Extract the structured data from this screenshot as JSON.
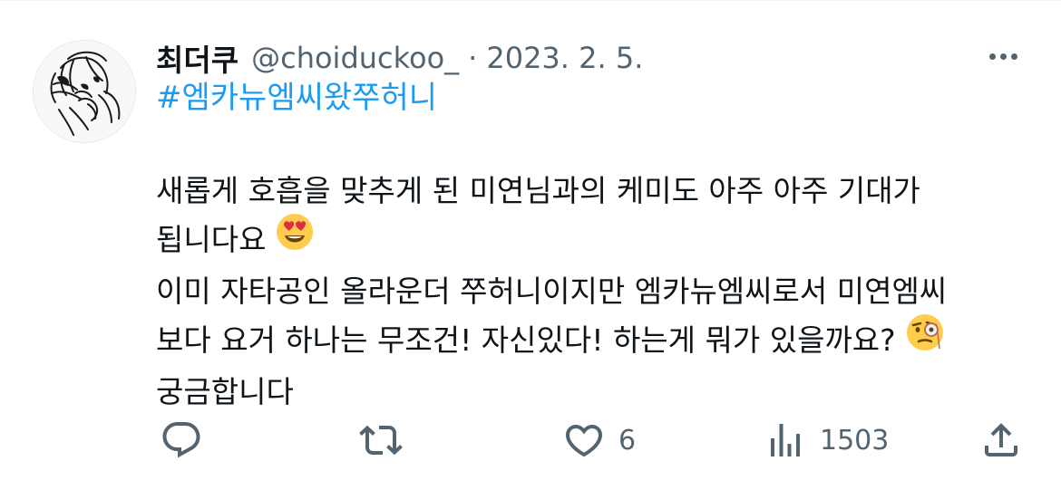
{
  "tweet": {
    "display_name": "최더쿠",
    "handle": "@choiduckoo_",
    "separator": "·",
    "date": "2023. 2. 5.",
    "hashtag": "#엠카뉴엠씨왔쭈허니",
    "lines": [
      "새롭게 호흡을 맞추게 된 미연님과의 케미도 아주 아주 기대가",
      "됩니다요",
      "이미 자타공인 올라운더 쭈허니이지만 엠카뉴엠씨로서 미연엠씨",
      "보다 요거 하나는 무조건! 자신있다! 하는게 뭐가 있을까요?",
      "궁금합니다"
    ],
    "emojis": [
      "heart-eyes-emoji",
      "monocle-face-emoji"
    ],
    "avatar": "avatar-drawing"
  },
  "actions": {
    "reply_icon": "reply-icon",
    "retweet_icon": "retweet-icon",
    "like_icon": "heart-icon",
    "like_count": "6",
    "views_icon": "analytics-icon",
    "views_count": "1503",
    "share_icon": "share-icon"
  },
  "colors": {
    "text": "#0f1419",
    "secondary": "#536471",
    "link": "#1d9bf0"
  }
}
